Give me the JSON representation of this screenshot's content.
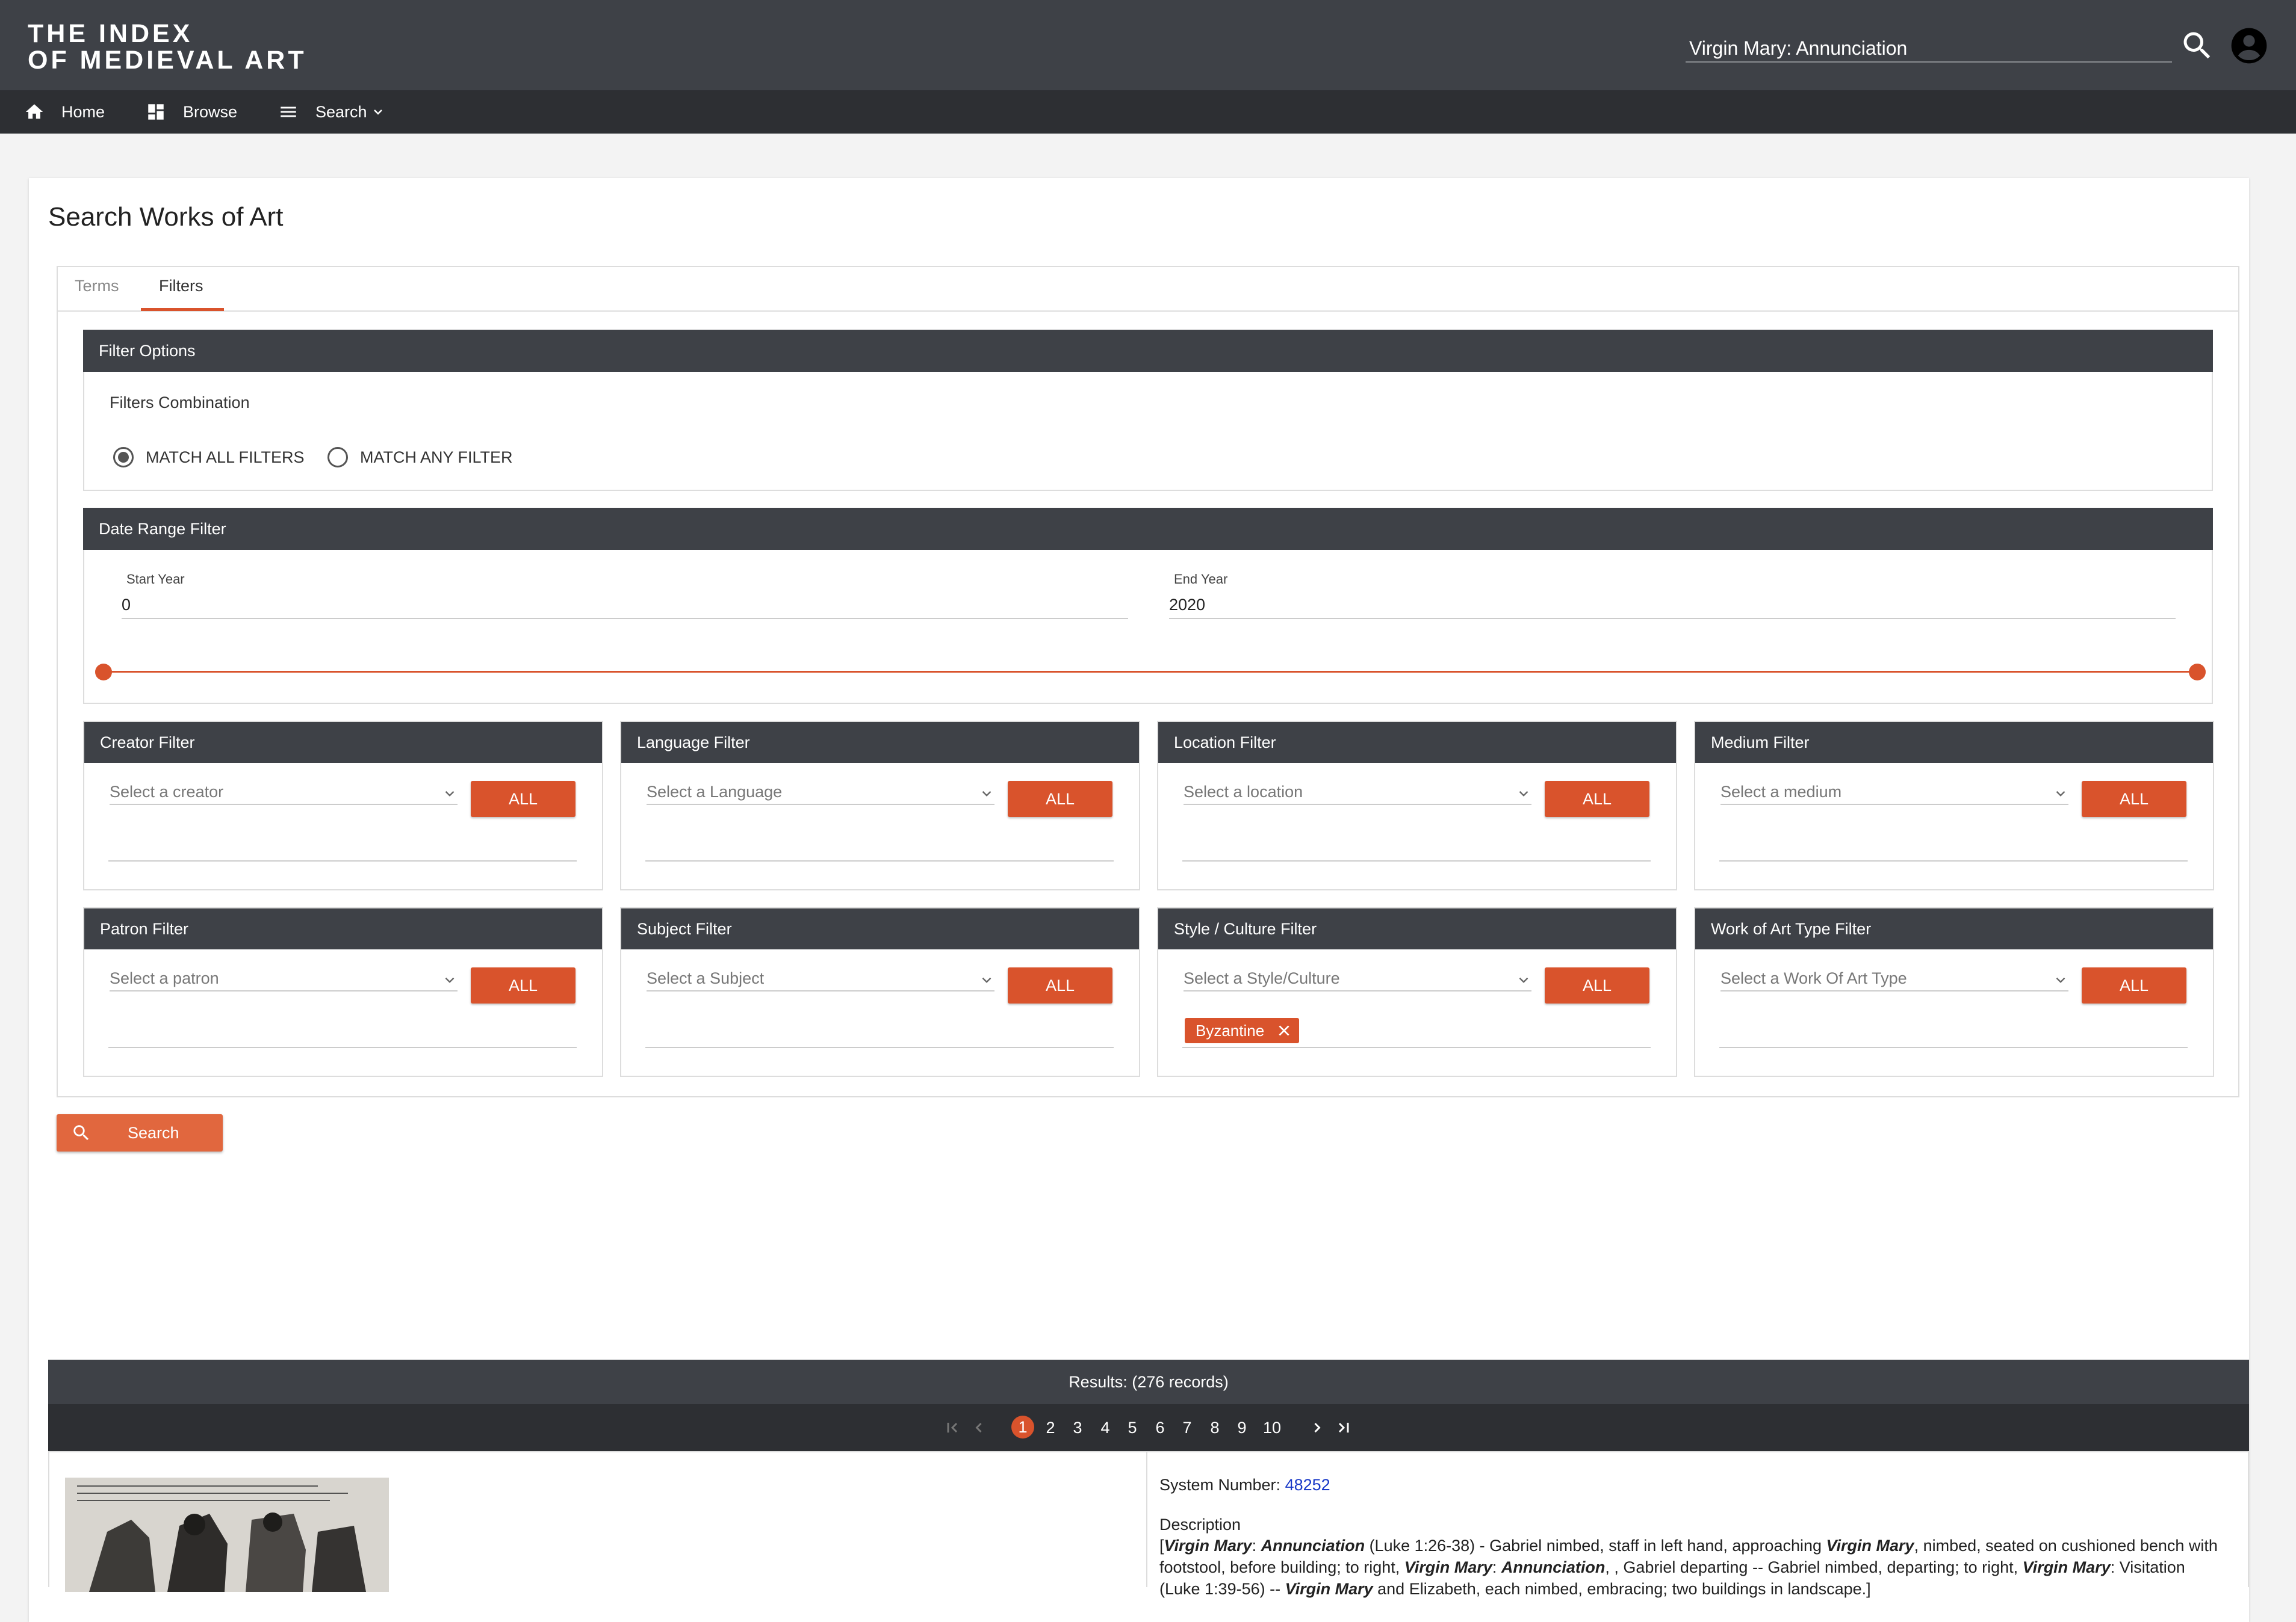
{
  "header": {
    "logo_line1": "THE INDEX",
    "logo_line2": "OF MEDIEVAL ART",
    "search_value": "Virgin Mary: Annunciation",
    "search_icon": "search-icon",
    "account_icon": "account-circle-icon"
  },
  "nav": {
    "home": "Home",
    "browse": "Browse",
    "search": "Search"
  },
  "page": {
    "title": "Search Works of Art",
    "tabs": [
      "Terms",
      "Filters"
    ],
    "active_tab": "Filters"
  },
  "filter_options": {
    "title": "Filter Options",
    "combination_label": "Filters Combination",
    "match_all": "MATCH ALL FILTERS",
    "match_any": "MATCH ANY FILTER",
    "selected": "MATCH ALL FILTERS"
  },
  "date_range": {
    "title": "Date Range Filter",
    "start_label": "Start Year",
    "start_value": "0",
    "end_label": "End Year",
    "end_value": "2020"
  },
  "filters": [
    {
      "title": "Creator Filter",
      "placeholder": "Select a creator",
      "button": "ALL",
      "chips": []
    },
    {
      "title": "Language Filter",
      "placeholder": "Select a Language",
      "button": "ALL",
      "chips": []
    },
    {
      "title": "Location Filter",
      "placeholder": "Select a location",
      "button": "ALL",
      "chips": []
    },
    {
      "title": "Medium Filter",
      "placeholder": "Select a medium",
      "button": "ALL",
      "chips": []
    },
    {
      "title": "Patron Filter",
      "placeholder": "Select a patron",
      "button": "ALL",
      "chips": []
    },
    {
      "title": "Subject Filter",
      "placeholder": "Select a Subject",
      "button": "ALL",
      "chips": []
    },
    {
      "title": "Style / Culture Filter",
      "placeholder": "Select a Style/Culture",
      "button": "ALL",
      "chips": [
        "Byzantine"
      ]
    },
    {
      "title": "Work of Art Type Filter",
      "placeholder": "Select a Work Of Art Type",
      "button": "ALL",
      "chips": []
    }
  ],
  "search_button": "Search",
  "results": {
    "summary": "Results: (276 records)",
    "pages": [
      "1",
      "2",
      "3",
      "4",
      "5",
      "6",
      "7",
      "8",
      "9",
      "10"
    ],
    "current_page": "1",
    "system_number_label": "System Number:",
    "system_number": "48252",
    "description_label": "Description",
    "description_line1_a": "[",
    "description_line1_b": "Virgin Mary",
    "description_line1_c": ": ",
    "description_line1_d": "Annunciation",
    "description_line1_e": " (Luke 1:26-38) - Gabriel nimbed, staff in left hand, approaching ",
    "description_line1_f": "Virgin Mary",
    "description_line1_g": ", nimbed, seated on cushioned bench with",
    "description_line2_a": "footstool, before building; to right, ",
    "description_line2_b": "Virgin Mary",
    "description_line2_c": ": ",
    "description_line2_d": "Annunciation",
    "description_line2_e": ", , Gabriel departing -- Gabriel nimbed, departing; to right, ",
    "description_line2_f": "Virgin Mary",
    "description_line2_g": ": Visitation",
    "description_line3_a": "(Luke 1:39-56) -- ",
    "description_line3_b": "Virgin Mary",
    "description_line3_c": " and Elizabeth, each nimbed, embracing; two buildings in landscape.]"
  },
  "colors": {
    "header_bg": "#3e4147",
    "nav_bg": "#2d2f33",
    "accent": "#d9532c",
    "link": "#1a3ac8"
  }
}
